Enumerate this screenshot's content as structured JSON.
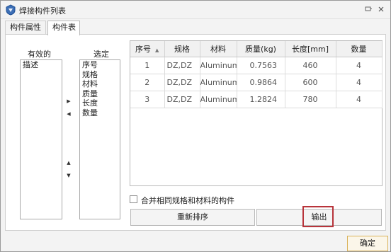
{
  "window": {
    "title": "焊接构件列表",
    "icon": "weld-app-icon",
    "pin_icon": "pin-icon",
    "close_icon": "close-icon"
  },
  "tabs": [
    {
      "label": "构件属性",
      "active": false
    },
    {
      "label": "构件表",
      "active": true
    }
  ],
  "available": {
    "label": "有效的",
    "items": [
      "描述"
    ]
  },
  "selected": {
    "label": "选定",
    "items": [
      "序号",
      "规格",
      "材料",
      "质量",
      "长度",
      "数量"
    ]
  },
  "move_buttons": {
    "add_icon": "arrow-right-icon",
    "remove_icon": "arrow-left-icon",
    "up_icon": "arrow-up-icon",
    "down_icon": "arrow-down-icon"
  },
  "table": {
    "columns": [
      "序号",
      "规格",
      "材料",
      "质量(kg)",
      "长度[mm]",
      "数量"
    ],
    "sort_column": "序号",
    "sort_icon": "sort-ascending-icon",
    "rows": [
      [
        "1",
        "DZ,DZ",
        "Aluminum",
        "0.7563",
        "460",
        "4"
      ],
      [
        "2",
        "DZ,DZ",
        "Aluminum",
        "0.9864",
        "600",
        "4"
      ],
      [
        "3",
        "DZ,DZ",
        "Aluminum",
        "1.2824",
        "780",
        "4"
      ]
    ]
  },
  "merge_checkbox": {
    "label": "合并相同规格和材料的构件",
    "checked": false
  },
  "buttons": {
    "resort": "重新排序",
    "export": "输出",
    "ok": "确定"
  },
  "colors": {
    "highlight_border": "#b8343b",
    "ok_border": "#d9b25a"
  }
}
